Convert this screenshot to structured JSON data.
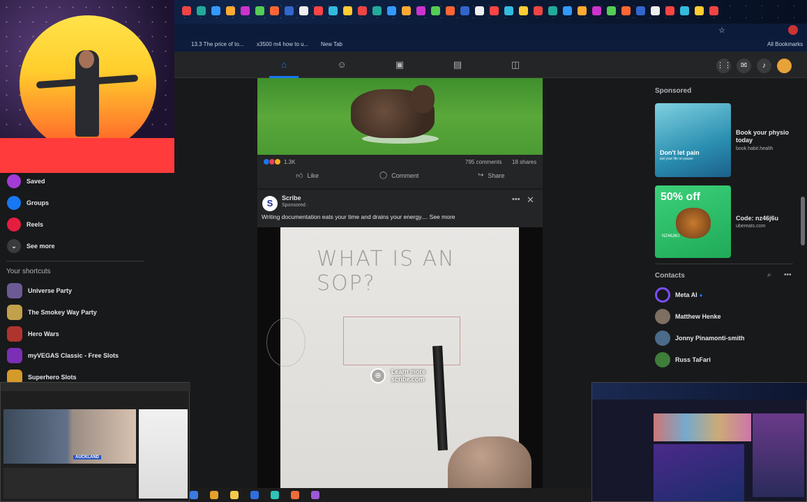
{
  "bookmarks": {
    "items": [
      "13.3 The price of to...",
      "x3500 m4 how to u...",
      "New Tab"
    ],
    "all_bookmarks": "All Bookmarks"
  },
  "feed": {
    "post1": {
      "reactions_count": "1.3K",
      "comments": "795 comments",
      "shares": "18 shares",
      "like": "Like",
      "comment": "Comment",
      "share": "Share"
    },
    "post2": {
      "author": "Scribe",
      "sponsored": "Sponsored · ",
      "text": "Writing documentation eats your time and drains your energy....",
      "see_more": "See more",
      "video_heading": "WHAT IS AN SOP?",
      "learn_more": "Learn more",
      "domain": "scribe.com"
    }
  },
  "sidebar": {
    "items": [
      {
        "label": "Saved",
        "color": "#a33bd6"
      },
      {
        "label": "Groups",
        "color": "#1877f2"
      },
      {
        "label": "Reels",
        "color": "#e41e3f"
      },
      {
        "label": "See more",
        "color": "#3a3b3c"
      }
    ],
    "shortcuts_title": "Your shortcuts",
    "shortcuts": [
      {
        "label": "Universe Party",
        "color": "#6b5b95"
      },
      {
        "label": "The Smokey Way Party",
        "color": "#c2a14b"
      },
      {
        "label": "Hero Wars",
        "color": "#b0342e"
      },
      {
        "label": "myVEGAS Classic - Free Slots",
        "color": "#7a2fb5"
      },
      {
        "label": "Superhero Slots",
        "color": "#d49a2a"
      }
    ]
  },
  "rightrail": {
    "sponsored_title": "Sponsored",
    "ads": [
      {
        "title": "Book your physio today",
        "source": "book.habit.health",
        "image_text": "Don't let pain",
        "image_sub": "put your life on pause"
      },
      {
        "title": "Code: nz46j6u",
        "source": "ubereats.com",
        "image_text": "50% off",
        "image_sub": "NZ46J6U"
      }
    ],
    "contacts_title": "Contacts",
    "contacts": [
      {
        "name": "Meta AI",
        "color": "#7b4dff"
      },
      {
        "name": "Matthew Henke",
        "color": "#7d6f62"
      },
      {
        "name": "Jonny Pinamonti-smith",
        "color": "#4a6b8a"
      },
      {
        "name": "Russ TaFari",
        "color": "#3f7d3a"
      }
    ]
  },
  "overlays": {
    "news_label": "AUCKLAND"
  },
  "colors": {
    "fb_blue": "#1877f2",
    "surface": "#242526",
    "background": "#18191a"
  }
}
